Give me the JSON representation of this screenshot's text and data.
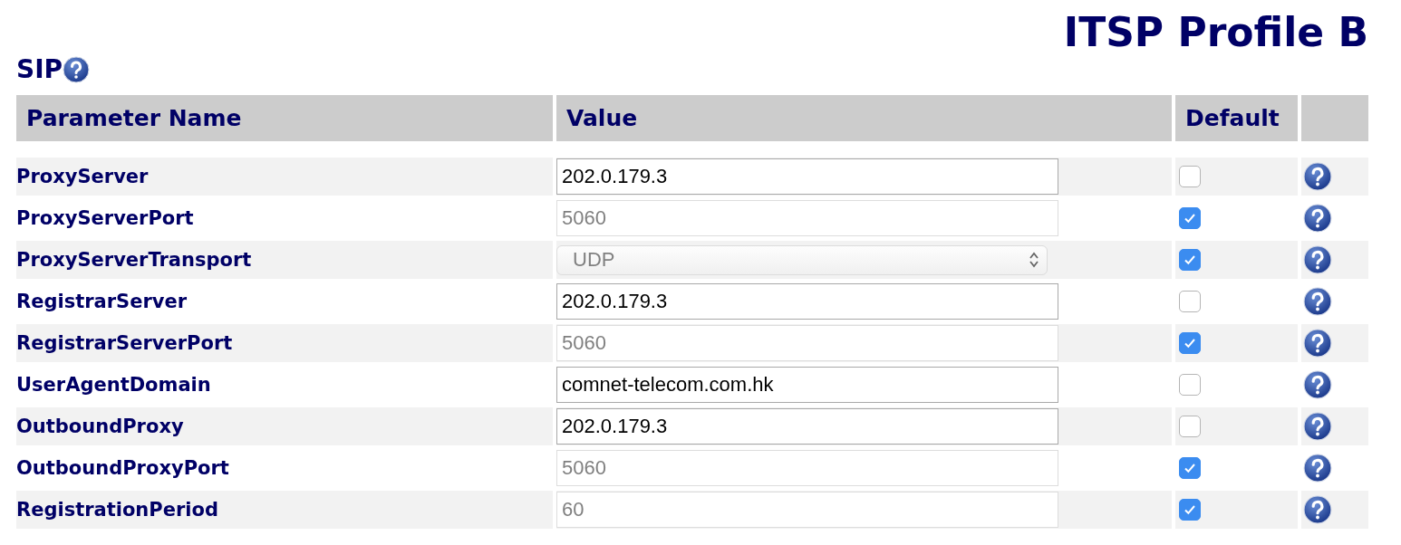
{
  "page_title": "ITSP Profile B",
  "section": {
    "title": "SIP"
  },
  "table": {
    "columns": [
      "Parameter Name",
      "Value",
      "Default"
    ],
    "rows": [
      {
        "name": "ProxyServer",
        "kind": "text",
        "value": "202.0.179.3",
        "default": false
      },
      {
        "name": "ProxyServerPort",
        "kind": "text",
        "value": "5060",
        "default": true
      },
      {
        "name": "ProxyServerTransport",
        "kind": "select",
        "value": "UDP",
        "default": true
      },
      {
        "name": "RegistrarServer",
        "kind": "text",
        "value": "202.0.179.3",
        "default": false
      },
      {
        "name": "RegistrarServerPort",
        "kind": "text",
        "value": "5060",
        "default": true
      },
      {
        "name": "UserAgentDomain",
        "kind": "text",
        "value": "comnet-telecom.com.hk",
        "default": false
      },
      {
        "name": "OutboundProxy",
        "kind": "text",
        "value": "202.0.179.3",
        "default": false
      },
      {
        "name": "OutboundProxyPort",
        "kind": "text",
        "value": "5060",
        "default": true
      },
      {
        "name": "RegistrationPeriod",
        "kind": "text",
        "value": "60",
        "default": true
      }
    ]
  }
}
